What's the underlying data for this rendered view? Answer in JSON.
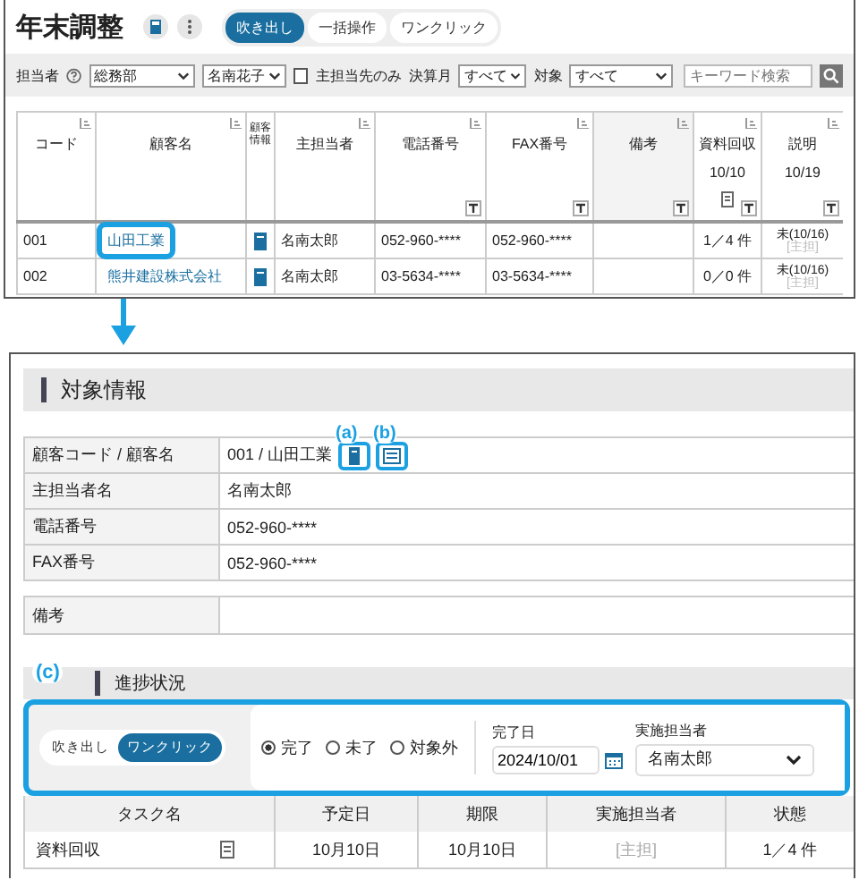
{
  "app": {
    "title": "年末調整",
    "modes": [
      {
        "label": "吹き出し",
        "selected": true
      },
      {
        "label": "一括操作",
        "selected": false
      },
      {
        "label": "ワンクリック",
        "selected": false
      }
    ]
  },
  "filters": {
    "assignee_label": "担当者",
    "department": "総務部",
    "person": "名南花子",
    "main_only": {
      "label": "主担当先のみ",
      "checked": false
    },
    "settlement_label": "決算月",
    "settlement": "すべて",
    "target_label": "対象",
    "target": "すべて",
    "search": {
      "placeholder": "キーワード検索"
    }
  },
  "clients_table": {
    "columns": [
      {
        "label": "コード"
      },
      {
        "label": "顧客名"
      },
      {
        "label": "顧客情報"
      },
      {
        "label": "主担当者"
      },
      {
        "label": "電話番号"
      },
      {
        "label": "FAX番号"
      },
      {
        "label": "備考"
      },
      {
        "label": "資料回収",
        "date": "10/10"
      },
      {
        "label": "説明",
        "date": "10/19"
      }
    ],
    "rows": [
      {
        "code": "001",
        "name": "山田工業",
        "highlighted": true,
        "manager": "名南太郎",
        "phone": "052-960-****",
        "fax": "052-960-****",
        "collection": "1／4 件",
        "explanation": "未(10/16)",
        "explanation_note": "[主担]"
      },
      {
        "code": "002",
        "name": "熊井建設株式会社",
        "highlighted": false,
        "manager": "名南太郎",
        "phone": "03-5634-****",
        "fax": "03-5634-****",
        "collection": "0／0 件",
        "explanation": "未(10/16)",
        "explanation_note": "[主担]"
      }
    ]
  },
  "detail": {
    "section_title": "対象情報",
    "fields": [
      {
        "label": "顧客コード / 顧客名",
        "value": "001 / 山田工業",
        "markers": [
          "(a)",
          "(b)"
        ]
      },
      {
        "label": "主担当者名",
        "value": "名南太郎"
      },
      {
        "label": "電話番号",
        "value": "052-960-****"
      },
      {
        "label": "FAX番号",
        "value": "052-960-****"
      }
    ],
    "note_label": "備考"
  },
  "progress": {
    "section_title": "進捗状況",
    "callout": {
      "marker": "(c)",
      "modes": [
        {
          "label": "吹き出し",
          "selected": false
        },
        {
          "label": "ワンクリック",
          "selected": true
        }
      ],
      "statuses": [
        {
          "label": "完了",
          "selected": true
        },
        {
          "label": "未了",
          "selected": false
        },
        {
          "label": "対象外",
          "selected": false
        }
      ],
      "date_label": "完了日",
      "date": "2024/10/01",
      "person_label": "実施担当者",
      "person": "名南太郎"
    },
    "columns": [
      "タスク名",
      "予定日",
      "期限",
      "実施担当者",
      "状態"
    ],
    "rows": [
      {
        "task": "資料回収",
        "planned": "10月10日",
        "deadline": "10月10日",
        "assignee": "[主担]",
        "status": "1／4 件"
      }
    ]
  }
}
